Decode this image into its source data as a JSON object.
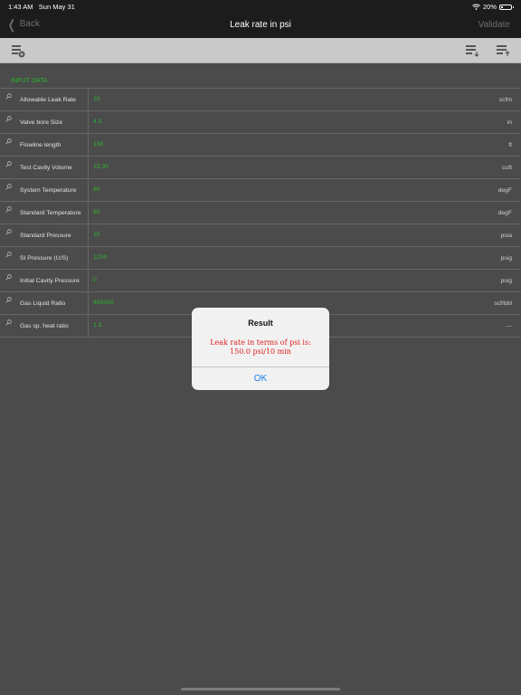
{
  "status": {
    "time": "1:43 AM",
    "date": "Sun May 31",
    "battery": "20%",
    "battery_level": 0.2
  },
  "nav": {
    "back_label": "Back",
    "title": "Leak rate in psi",
    "validate_label": "Validate"
  },
  "toolbar": {
    "icons": [
      "add-row-icon",
      "import-list-icon",
      "export-list-icon"
    ]
  },
  "section": {
    "title": "INPUT DATA"
  },
  "rows": [
    {
      "label": "Allowable Leak Rate",
      "value": "10",
      "unit": "scfm"
    },
    {
      "label": "Valve bore Size",
      "value": "4.5",
      "unit": "in"
    },
    {
      "label": "Flowline length",
      "value": "138",
      "unit": "ft"
    },
    {
      "label": "Test Cavity Volume",
      "value": "15.35",
      "unit": "cuft"
    },
    {
      "label": "System Temperature",
      "value": "80",
      "unit": "degF"
    },
    {
      "label": "Standard Temperature",
      "value": "60",
      "unit": "degF"
    },
    {
      "label": "Standard Pressure",
      "value": "15",
      "unit": "psia"
    },
    {
      "label": "SI Pressure (U/S)",
      "value": "1200",
      "unit": "psig"
    },
    {
      "label": "Initial Cavity Pressure",
      "value": "0",
      "unit": "psig"
    },
    {
      "label": "Gas Liquid Ratio",
      "value": "450000",
      "unit": "scf/bbl"
    },
    {
      "label": "Gas sp. heat ratio",
      "value": "1.3",
      "unit": "---"
    }
  ],
  "dialog": {
    "title": "Result",
    "message_line1": "Leak rate in terms of psi is:",
    "message_line2": "150.0 psi/10 min",
    "ok_label": "OK"
  },
  "colors": {
    "accent_green": "#2fb52f",
    "alert_red": "#e01e1e",
    "link_blue": "#1a7ff0"
  }
}
